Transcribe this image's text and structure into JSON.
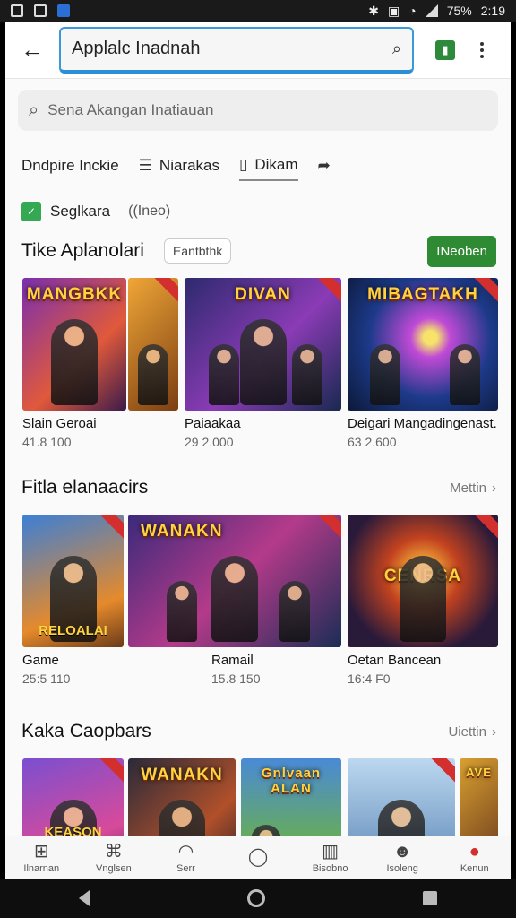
{
  "status_bar": {
    "battery": "75%",
    "time": "2:19"
  },
  "appbar": {
    "search_value": "Applalc Inadnah"
  },
  "search": {
    "placeholder": "Sena Akangan Inatiauan"
  },
  "chips": [
    {
      "label": "Dndpire Inckie",
      "icon": "none"
    },
    {
      "label": "Niarakas",
      "icon": "list-icon"
    },
    {
      "label": "Dikam",
      "icon": "document-icon"
    },
    {
      "label": "",
      "icon": "share-icon"
    }
  ],
  "meta": {
    "label": "Seglkara",
    "sub": "((Ineo)"
  },
  "sections": [
    {
      "title": "Tike Aplanolari",
      "pill": "Eantbthk",
      "action": "INeoben",
      "items": [
        {
          "title": "Slain Geroai",
          "sub": "41.8 100",
          "art_title": "MANGBKK"
        },
        {
          "title": "Paiaakaa",
          "sub": "29 2.000",
          "art_title": "DIVAN"
        },
        {
          "title": "Deigari Mangadingenast.",
          "sub": "63 2.600",
          "art_title": "MIBAGTAKH"
        }
      ]
    },
    {
      "title": "Fitla elanaacirs",
      "more": "Mettin",
      "items": [
        {
          "title": "Game",
          "sub": "25:5 110",
          "art_title": "RELOALAI"
        },
        {
          "title": "Ramail",
          "sub": "15.8 150",
          "art_title": "WANAKN"
        },
        {
          "title": "Oetan Bancean",
          "sub": "16:4 F0",
          "art_title": "CENRSA"
        }
      ]
    },
    {
      "title": "Kaka Caopbars",
      "more": "Uiettin",
      "items": [
        {
          "art_title": "KEASON"
        },
        {
          "art_title": "WANAKN"
        },
        {
          "art_title": "Gnlvaan ALAN"
        },
        {
          "art_title": ""
        },
        {
          "art_title": "AVE"
        }
      ]
    }
  ],
  "bottom_nav": [
    {
      "label": "Ilnarnan",
      "icon": "grid-icon"
    },
    {
      "label": "Vnglsen",
      "icon": "game-icon"
    },
    {
      "label": "Serr",
      "icon": "chat-icon"
    },
    {
      "label": "",
      "icon": "comment-icon"
    },
    {
      "label": "Bisobno",
      "icon": "books-icon"
    },
    {
      "label": "Isoleng",
      "icon": "people-icon"
    },
    {
      "label": "Kenun",
      "icon": "profile-icon"
    }
  ],
  "colors": {
    "accent": "#2e8b34",
    "focus_border": "#2b8ed6"
  }
}
